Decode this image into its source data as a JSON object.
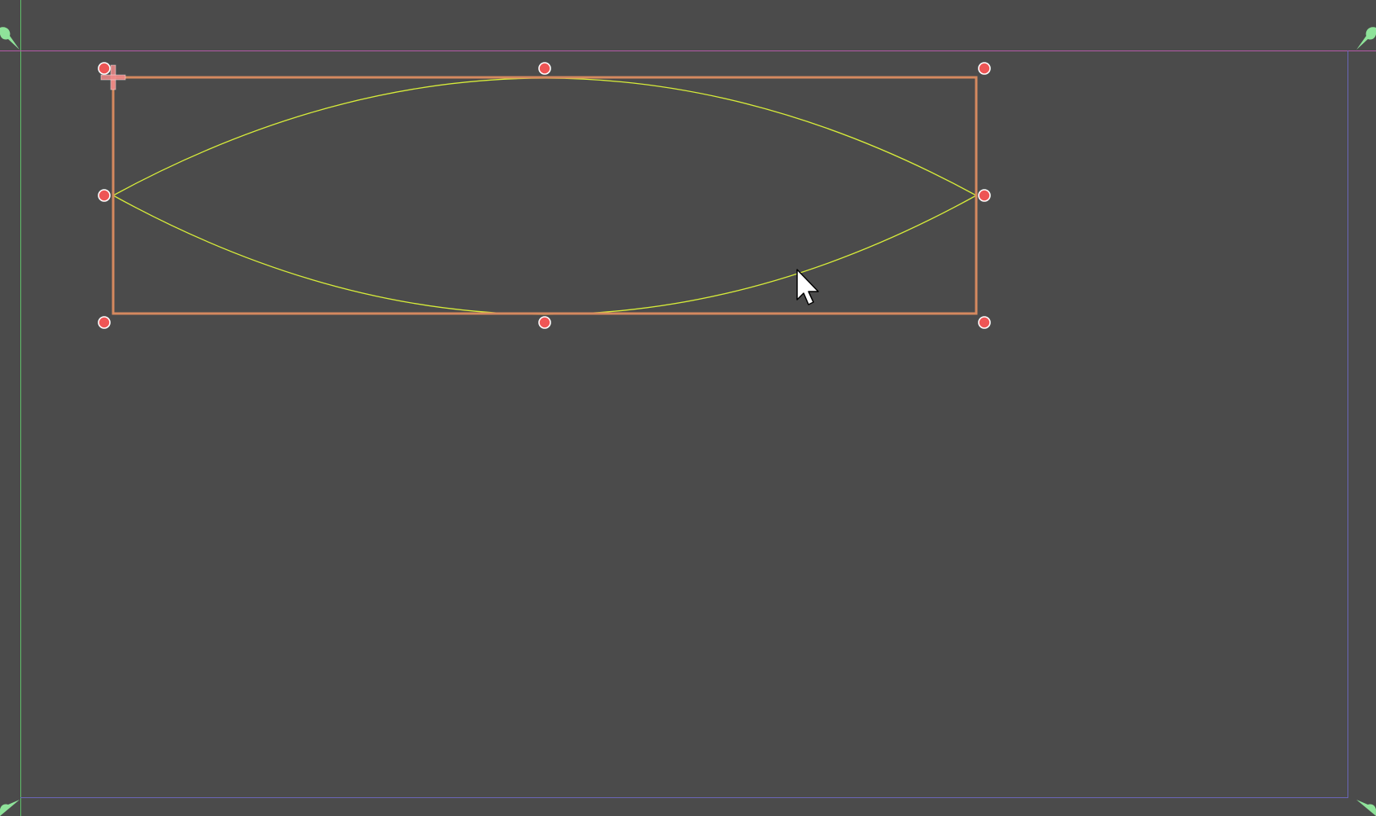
{
  "editor": {
    "mode": "canvas-item-editor",
    "colors": {
      "background": "#4b4b4b",
      "selection_rect": "#d5895f",
      "curve": "#d7ec3a",
      "handle_fill": "#ee5555",
      "handle_stroke": "#ffffff",
      "anchor_marker": "#8fe39a",
      "viewport_left_guide": "#5fbf6a",
      "viewport_top_guide": "#b35aa8",
      "viewport_border": "#6a66b8",
      "pivot": "#f08a8a"
    },
    "icons": {
      "pivot": "pivot-cross-icon",
      "cursor": "mouse-pointer-icon",
      "anchor": "anchor-pin-icon"
    }
  }
}
